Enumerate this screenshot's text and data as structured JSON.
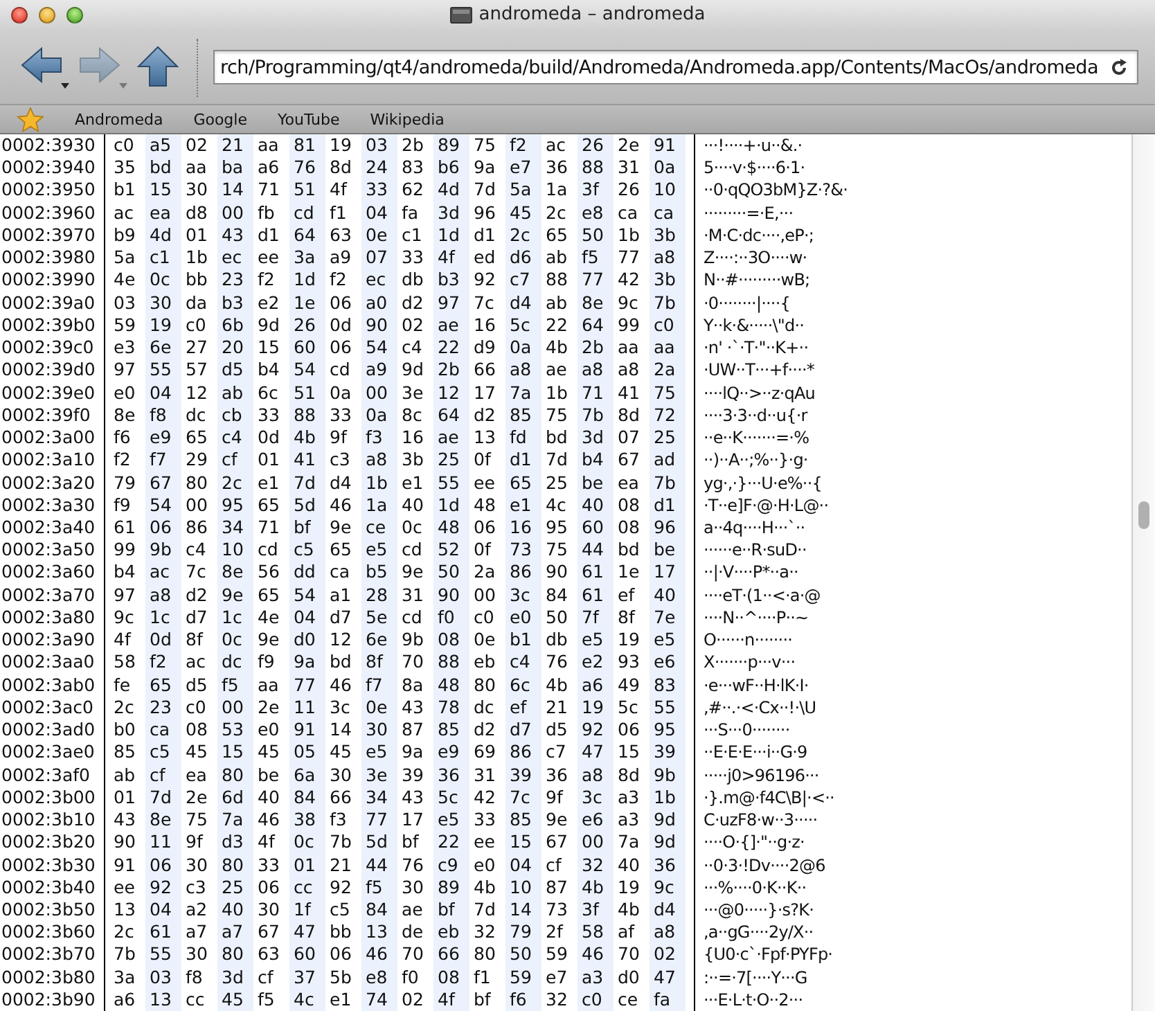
{
  "window": {
    "title": "andromeda – andromeda"
  },
  "toolbar": {
    "buttons": [
      {
        "kind": "back",
        "disabled": false
      },
      {
        "kind": "forward",
        "disabled": true
      },
      {
        "kind": "up",
        "disabled": false
      }
    ],
    "address": "rch/Programming/qt4/andromeda/build/Andromeda/Andromeda.app/Contents/MacOs/andromeda"
  },
  "bookmarks": [
    "Andromeda",
    "Google",
    "YouTube",
    "Wikipedia"
  ],
  "hex_view": {
    "rows": [
      {
        "offset": "0002:3930",
        "bytes": "c0 a5 02 21 aa 81 19 03 2b 89 75 f2 ac 26 2e 91",
        "text": "···!····+·u··&.·"
      },
      {
        "offset": "0002:3940",
        "bytes": "35 bd aa ba a6 76 8d 24 83 b6 9a e7 36 88 31 0a",
        "text": "5····v·$····6·1·"
      },
      {
        "offset": "0002:3950",
        "bytes": "b1 15 30 14 71 51 4f 33 62 4d 7d 5a 1a 3f 26 10",
        "text": "··0·qQO3bM}Z·?&·"
      },
      {
        "offset": "0002:3960",
        "bytes": "ac ea d8 00 fb cd f1 04 fa 3d 96 45 2c e8 ca ca",
        "text": "·········=·E,···"
      },
      {
        "offset": "0002:3970",
        "bytes": "b9 4d 01 43 d1 64 63 0e c1 1d d1 2c 65 50 1b 3b",
        "text": "·M·C·dc····,eP·;"
      },
      {
        "offset": "0002:3980",
        "bytes": "5a c1 1b ec ee 3a a9 07 33 4f ed d6 ab f5 77 a8",
        "text": "Z····:··3O····w·"
      },
      {
        "offset": "0002:3990",
        "bytes": "4e 0c bb 23 f2 1d f2 ec db b3 92 c7 88 77 42 3b",
        "text": "N··#·········wB;"
      },
      {
        "offset": "0002:39a0",
        "bytes": "03 30 da b3 e2 1e 06 a0 d2 97 7c d4 ab 8e 9c 7b",
        "text": "·0········|····{"
      },
      {
        "offset": "0002:39b0",
        "bytes": "59 19 c0 6b 9d 26 0d 90 02 ae 16 5c 22 64 99 c0",
        "text": "Y··k·&·····\\\"d··"
      },
      {
        "offset": "0002:39c0",
        "bytes": "e3 6e 27 20 15 60 06 54 c4 22 d9 0a 4b 2b aa aa",
        "text": "·n' ·`·T·\"··K+··"
      },
      {
        "offset": "0002:39d0",
        "bytes": "97 55 57 d5 b4 54 cd a9 9d 2b 66 a8 ae a8 a8 2a",
        "text": "·UW··T···+f····*"
      },
      {
        "offset": "0002:39e0",
        "bytes": "e0 04 12 ab 6c 51 0a 00 3e 12 17 7a 1b 71 41 75",
        "text": "····lQ··>··z·qAu"
      },
      {
        "offset": "0002:39f0",
        "bytes": "8e f8 dc cb 33 88 33 0a 8c 64 d2 85 75 7b 8d 72",
        "text": "····3·3··d··u{·r"
      },
      {
        "offset": "0002:3a00",
        "bytes": "f6 e9 65 c4 0d 4b 9f f3 16 ae 13 fd bd 3d 07 25",
        "text": "··e··K·······=·%"
      },
      {
        "offset": "0002:3a10",
        "bytes": "f2 f7 29 cf 01 41 c3 a8 3b 25 0f d1 7d b4 67 ad",
        "text": "··)··A··;%··}·g·"
      },
      {
        "offset": "0002:3a20",
        "bytes": "79 67 80 2c e1 7d d4 1b e1 55 ee 65 25 be ea 7b",
        "text": "yg·,·}···U·e%··{"
      },
      {
        "offset": "0002:3a30",
        "bytes": "f9 54 00 95 65 5d 46 1a 40 1d 48 e1 4c 40 08 d1",
        "text": "·T··e]F·@·H·L@··"
      },
      {
        "offset": "0002:3a40",
        "bytes": "61 06 86 34 71 bf 9e ce 0c 48 06 16 95 60 08 96",
        "text": "a··4q····H···`··"
      },
      {
        "offset": "0002:3a50",
        "bytes": "99 9b c4 10 cd c5 65 e5 cd 52 0f 73 75 44 bd be",
        "text": "······e··R·suD··"
      },
      {
        "offset": "0002:3a60",
        "bytes": "b4 ac 7c 8e 56 dd ca b5 9e 50 2a 86 90 61 1e 17",
        "text": "··|·V····P*··a··"
      },
      {
        "offset": "0002:3a70",
        "bytes": "97 a8 d2 9e 65 54 a1 28 31 90 00 3c 84 61 ef 40",
        "text": "····eT·(1··<·a·@"
      },
      {
        "offset": "0002:3a80",
        "bytes": "9c 1c d7 1c 4e 04 d7 5e cd f0 c0 e0 50 7f 8f 7e",
        "text": "····N··^····P··~"
      },
      {
        "offset": "0002:3a90",
        "bytes": "4f 0d 8f 0c 9e d0 12 6e 9b 08 0e b1 db e5 19 e5",
        "text": "O······n········"
      },
      {
        "offset": "0002:3aa0",
        "bytes": "58 f2 ac dc f9 9a bd 8f 70 88 eb c4 76 e2 93 e6",
        "text": "X·······p···v···"
      },
      {
        "offset": "0002:3ab0",
        "bytes": "fe 65 d5 f5 aa 77 46 f7 8a 48 80 6c 4b a6 49 83",
        "text": "·e···wF··H·lK·I·"
      },
      {
        "offset": "0002:3ac0",
        "bytes": "2c 23 c0 00 2e 11 3c 0e 43 78 dc ef 21 19 5c 55",
        "text": ",#··.·<·Cx··!·\\U"
      },
      {
        "offset": "0002:3ad0",
        "bytes": "b0 ca 08 53 e0 91 14 30 87 85 d2 d7 d5 92 06 95",
        "text": "···S···0········"
      },
      {
        "offset": "0002:3ae0",
        "bytes": "85 c5 45 15 45 05 45 e5 9a e9 69 86 c7 47 15 39",
        "text": "··E·E·E···i··G·9"
      },
      {
        "offset": "0002:3af0",
        "bytes": "ab cf ea 80 be 6a 30 3e 39 36 31 39 36 a8 8d 9b",
        "text": "·····j0>96196···"
      },
      {
        "offset": "0002:3b00",
        "bytes": "01 7d 2e 6d 40 84 66 34 43 5c 42 7c 9f 3c a3 1b",
        "text": "·}.m@·f4C\\B|·<··"
      },
      {
        "offset": "0002:3b10",
        "bytes": "43 8e 75 7a 46 38 f3 77 17 e5 33 85 9e e6 a3 9d",
        "text": "C·uzF8·w··3·····"
      },
      {
        "offset": "0002:3b20",
        "bytes": "90 11 9f d3 4f 0c 7b 5d bf 22 ee 15 67 00 7a 9d",
        "text": "····O·{]·\"··g·z·"
      },
      {
        "offset": "0002:3b30",
        "bytes": "91 06 30 80 33 01 21 44 76 c9 e0 04 cf 32 40 36",
        "text": "··0·3·!Dv····2@6"
      },
      {
        "offset": "0002:3b40",
        "bytes": "ee 92 c3 25 06 cc 92 f5 30 89 4b 10 87 4b 19 9c",
        "text": "···%····0·K··K··"
      },
      {
        "offset": "0002:3b50",
        "bytes": "13 04 a2 40 30 1f c5 84 ae bf 7d 14 73 3f 4b d4",
        "text": "···@0·····}·s?K·"
      },
      {
        "offset": "0002:3b60",
        "bytes": "2c 61 a7 a7 67 47 bb 13 de eb 32 79 2f 58 af a8",
        "text": ",a··gG····2y/X··"
      },
      {
        "offset": "0002:3b70",
        "bytes": "7b 55 30 80 63 60 06 46 70 66 80 50 59 46 70 02",
        "text": "{U0·c`·Fpf·PYFp·"
      },
      {
        "offset": "0002:3b80",
        "bytes": "3a 03 f8 3d cf 37 5b e8 f0 08 f1 59 e7 a3 d0 47",
        "text": ":··=·7[····Y···G"
      },
      {
        "offset": "0002:3b90",
        "bytes": "a6 13 cc 45 f5 4c e1 74 02 4f bf f6 32 c0 ce fa",
        "text": "···E·L·t·O··2···"
      }
    ]
  }
}
